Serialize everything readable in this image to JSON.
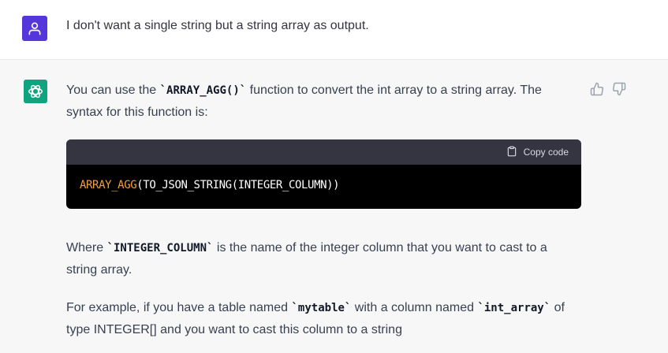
{
  "user": {
    "message": "I don't want a single string but a string array as output."
  },
  "assistant": {
    "p1_before": "You can use the ",
    "p1_code": "`ARRAY_AGG()`",
    "p1_after": " function to convert the int array to a string array. The syntax for this function is:",
    "code_block": {
      "copy_label": "Copy code",
      "fn_token": "ARRAY_AGG",
      "rest": "(TO_JSON_STRING(INTEGER_COLUMN))"
    },
    "p2_before": "Where ",
    "p2_code": "`INTEGER_COLUMN`",
    "p2_after": " is the name of the integer column that you want to cast to a string array.",
    "p3_before": "For example, if you have a table named ",
    "p3_code1": "`mytable`",
    "p3_mid": " with a column named ",
    "p3_code2": "`int_array`",
    "p3_after": " of type INTEGER[] and you want to cast this column to a string"
  },
  "icons": {
    "user_avatar": "user-icon",
    "bot_avatar": "openai-logo-icon",
    "thumb_up": "thumbs-up-icon",
    "thumb_down": "thumbs-down-icon",
    "copy": "clipboard-icon"
  },
  "colors": {
    "user_avatar_bg": "#5436da",
    "bot_avatar_bg": "#10a37f",
    "code_fn": "#f0a13c"
  }
}
